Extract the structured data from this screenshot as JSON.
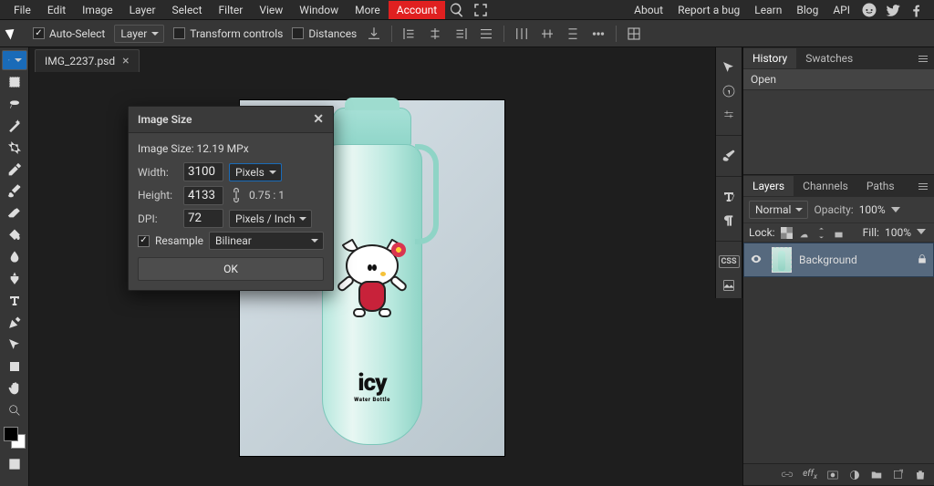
{
  "menubar": {
    "items": [
      "File",
      "Edit",
      "Image",
      "Layer",
      "Select",
      "Filter",
      "View",
      "Window",
      "More",
      "Account"
    ],
    "right": [
      "About",
      "Report a bug",
      "Learn",
      "Blog",
      "API"
    ]
  },
  "optbar": {
    "autoselect": "Auto-Select",
    "layer": "Layer",
    "transform": "Transform controls",
    "distances": "Distances"
  },
  "doc": {
    "tabname": "IMG_2237.psd"
  },
  "dialog": {
    "title": "Image Size",
    "subtitle": "Image Size: 12.19 MPx",
    "width_label": "Width:",
    "width": "3100",
    "width_unit": "Pixels",
    "height_label": "Height:",
    "height": "4133",
    "ratio": "0.75 : 1",
    "dpi_label": "DPI:",
    "dpi": "72",
    "dpi_unit": "Pixels / Inch",
    "resample": "Resample",
    "resample_method": "Bilinear",
    "ok": "OK"
  },
  "panels": {
    "history": {
      "tab": "History",
      "swatches": "Swatches",
      "open": "Open"
    },
    "layers": {
      "tab_layers": "Layers",
      "tab_channels": "Channels",
      "tab_paths": "Paths",
      "blend": "Normal",
      "opacity_label": "Opacity:",
      "opacity": "100%",
      "lock_label": "Lock:",
      "fill_label": "Fill:",
      "fill": "100%",
      "layer0": "Background"
    }
  },
  "canvas": {
    "brand1": "icy",
    "brand2": "Water Bottle"
  },
  "rstrip": {
    "css": "CSS"
  }
}
